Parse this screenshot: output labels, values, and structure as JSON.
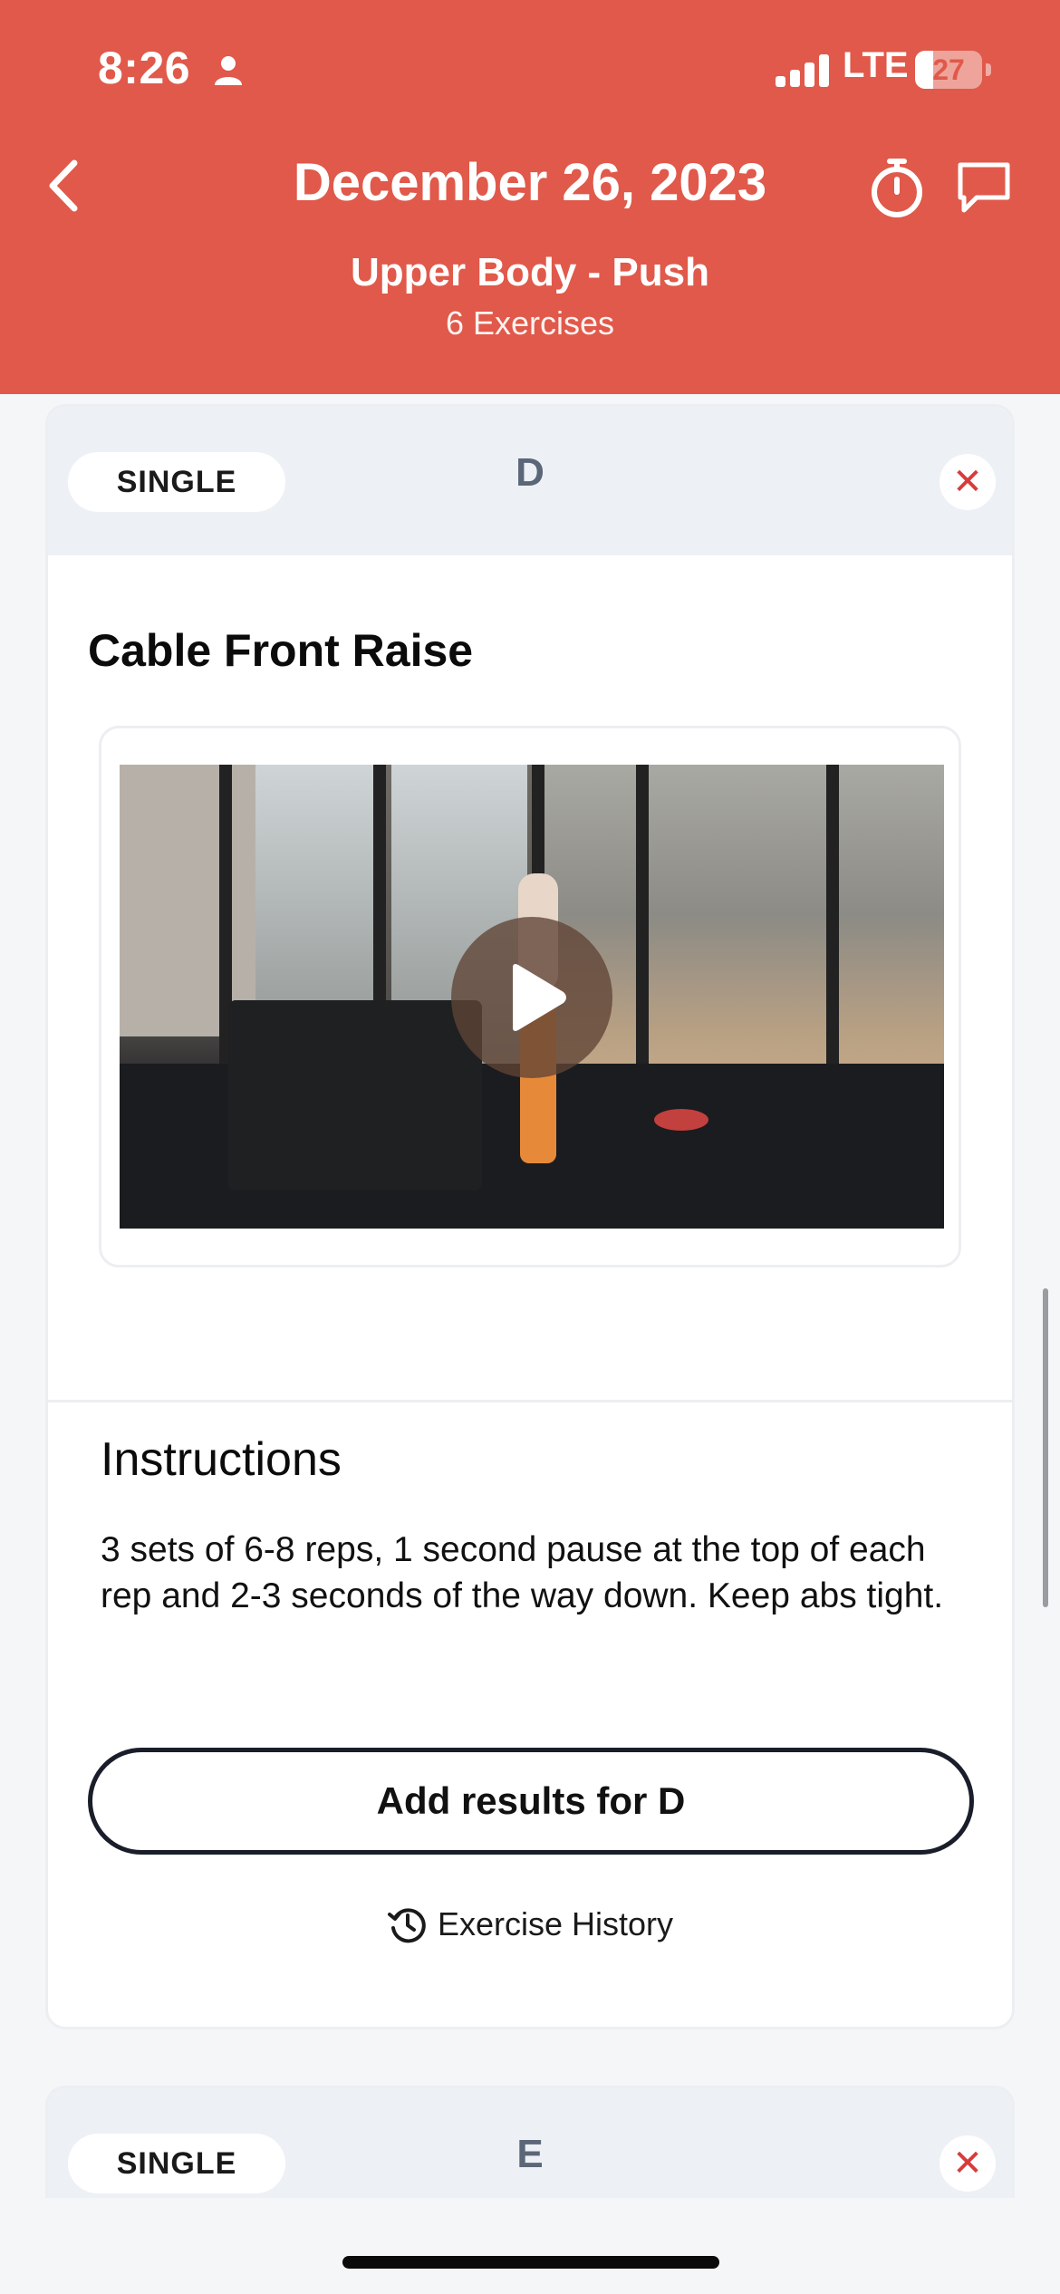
{
  "status_bar": {
    "time": "8:26",
    "carrier": "LTE",
    "battery": "27",
    "battery_level": 0.27
  },
  "header": {
    "title": "December 26, 2023",
    "workout_name": "Upper Body - Push",
    "exercise_count": "6 Exercises"
  },
  "colors": {
    "brand": "#e0594a",
    "close_x": "#d83b3b",
    "section_letter": "#5b6778"
  },
  "exercise_cards": [
    {
      "type_label": "SINGLE",
      "letter": "D",
      "name": "Cable Front Raise",
      "instructions_heading": "Instructions",
      "instructions": "3 sets of 6-8 reps, 1 second pause at the top of each rep and 2-3 seconds of the way down. Keep abs tight.",
      "add_results_label": "Add results for D",
      "history_label": "Exercise History",
      "close_symbol": "✕"
    },
    {
      "type_label": "SINGLE",
      "letter": "E",
      "close_symbol": "✕"
    }
  ],
  "icons": {
    "back": "chevron-left-icon",
    "timer": "stopwatch-icon",
    "chat": "chat-bubble-icon",
    "play": "play-icon",
    "history": "history-clock-icon",
    "person": "person-icon"
  }
}
